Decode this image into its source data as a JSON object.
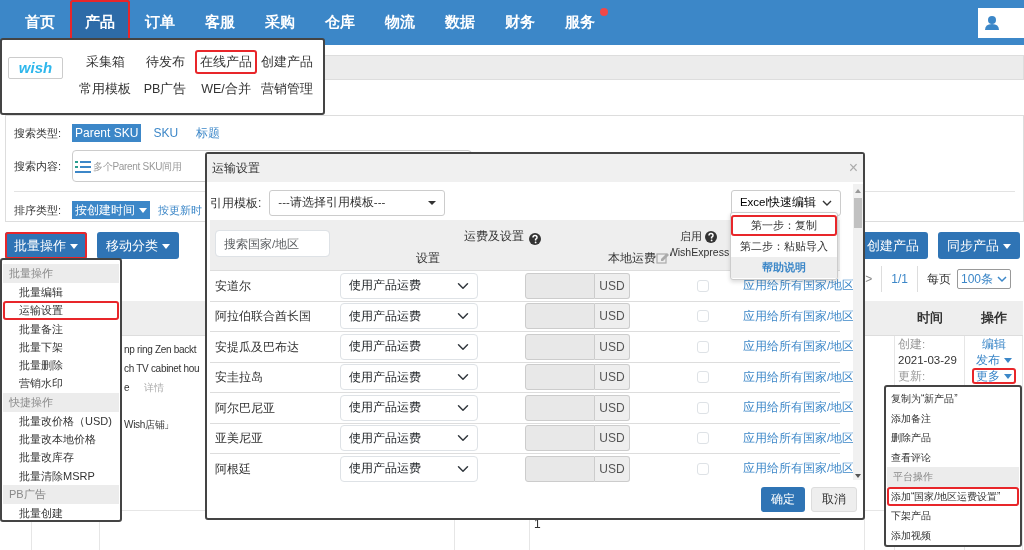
{
  "nav": {
    "items": [
      {
        "label": "首页",
        "selected": false,
        "annotated": false,
        "dot": false
      },
      {
        "label": "产品",
        "selected": true,
        "annotated": true,
        "dot": false
      },
      {
        "label": "订单",
        "selected": false,
        "annotated": false,
        "dot": false
      },
      {
        "label": "客服",
        "selected": false,
        "annotated": false,
        "dot": false
      },
      {
        "label": "采购",
        "selected": false,
        "annotated": false,
        "dot": false
      },
      {
        "label": "仓库",
        "selected": false,
        "annotated": false,
        "dot": false
      },
      {
        "label": "物流",
        "selected": false,
        "annotated": false,
        "dot": false
      },
      {
        "label": "数据",
        "selected": false,
        "annotated": false,
        "dot": false
      },
      {
        "label": "财务",
        "selected": false,
        "annotated": false,
        "dot": false
      },
      {
        "label": "服务",
        "selected": false,
        "annotated": false,
        "dot": true
      }
    ]
  },
  "product_menu": {
    "logo": "wish",
    "items": [
      {
        "label": "采集箱",
        "annotated": false
      },
      {
        "label": "待发布",
        "annotated": false
      },
      {
        "label": "在线产品",
        "annotated": true
      },
      {
        "label": "创建产品",
        "annotated": false
      },
      {
        "label": "常用模板",
        "annotated": false
      },
      {
        "label": "PB广告",
        "annotated": false
      },
      {
        "label": "WE/合并",
        "annotated": false
      },
      {
        "label": "营销管理",
        "annotated": false
      }
    ]
  },
  "search": {
    "type_label": "搜索类型:",
    "types": [
      {
        "label": "Parent SKU",
        "selected": true
      },
      {
        "label": "SKU",
        "selected": false
      },
      {
        "label": "标题",
        "selected": false
      }
    ],
    "content_label": "搜索内容:",
    "placeholder": "多个Parent SKU间用",
    "sort_label": "排序类型:",
    "sorts": [
      {
        "label": "按创建时间",
        "selected": true
      },
      {
        "label": "按更新时",
        "selected": false
      }
    ]
  },
  "toolbar": {
    "left": [
      {
        "label": "批量操作",
        "dropdown": true,
        "annotated": true
      },
      {
        "label": "移动分类",
        "dropdown": true,
        "annotated": false
      }
    ],
    "right": [
      {
        "label": "创建产品",
        "dropdown": false,
        "annotated": false
      },
      {
        "label": "同步产品",
        "dropdown": true,
        "annotated": false
      }
    ]
  },
  "pagination": {
    "next": ">",
    "pages": "1/1",
    "per_page_label": "每页",
    "per_page": "100条"
  },
  "table": {
    "columns": [
      "时间",
      "操作"
    ],
    "product": {
      "title_lines": [
        "np ring Zen backt",
        "ch TV cabinet hou",
        "e"
      ],
      "detail_link": "详情",
      "shop": "Wish店铺」",
      "created_label": "创建:",
      "created": "2021-03-29",
      "updated_label": "更新:",
      "actions": [
        {
          "label": "编辑",
          "dropdown": false,
          "annotated": false
        },
        {
          "label": "发布",
          "dropdown": true,
          "annotated": false
        },
        {
          "label": "更多",
          "dropdown": true,
          "annotated": true
        }
      ]
    },
    "next_row_cell": "1"
  },
  "bulk_menu": {
    "items": [
      {
        "kind": "header",
        "label": "批量操作",
        "annotated": false
      },
      {
        "kind": "item",
        "label": "批量编辑",
        "annotated": false
      },
      {
        "kind": "item",
        "label": "运输设置",
        "annotated": true
      },
      {
        "kind": "item",
        "label": "批量备注",
        "annotated": false
      },
      {
        "kind": "item",
        "label": "批量下架",
        "annotated": false
      },
      {
        "kind": "item",
        "label": "批量删除",
        "annotated": false
      },
      {
        "kind": "item",
        "label": "营销水印",
        "annotated": false
      },
      {
        "kind": "header",
        "label": "快捷操作",
        "annotated": false
      },
      {
        "kind": "item",
        "label": "批量改价格（USD)",
        "annotated": false
      },
      {
        "kind": "item",
        "label": "批量改本地价格",
        "annotated": false
      },
      {
        "kind": "item",
        "label": "批量改库存",
        "annotated": false
      },
      {
        "kind": "item",
        "label": "批量清除MSRP",
        "annotated": false
      },
      {
        "kind": "header",
        "label": "PB广告",
        "annotated": false
      },
      {
        "kind": "item",
        "label": "批量创建",
        "annotated": false
      }
    ]
  },
  "modal": {
    "title": "运输设置",
    "close": "×",
    "template_label": "引用模板:",
    "template_placeholder": "---请选择引用模板---",
    "excel_button": "Excel快速编辑",
    "search_placeholder": "搜索国家/地区",
    "group_header": "运费及设置",
    "col_setting": "设置",
    "col_local_fee": "本地运费",
    "col_enable": "启用",
    "col_enable_sub": "WishExpress",
    "rows": [
      {
        "country": "安道尔",
        "setting": "使用产品运费",
        "currency": "USD",
        "checked": false,
        "apply_link": "应用给所有国家/地区"
      },
      {
        "country": "阿拉伯联合酋长国",
        "setting": "使用产品运费",
        "currency": "USD",
        "checked": false,
        "apply_link": "应用给所有国家/地区"
      },
      {
        "country": "安提瓜及巴布达",
        "setting": "使用产品运费",
        "currency": "USD",
        "checked": false,
        "apply_link": "应用给所有国家/地区"
      },
      {
        "country": "安圭拉岛",
        "setting": "使用产品运费",
        "currency": "USD",
        "checked": false,
        "apply_link": "应用给所有国家/地区"
      },
      {
        "country": "阿尔巴尼亚",
        "setting": "使用产品运费",
        "currency": "USD",
        "checked": false,
        "apply_link": "应用给所有国家/地区"
      },
      {
        "country": "亚美尼亚",
        "setting": "使用产品运费",
        "currency": "USD",
        "checked": false,
        "apply_link": "应用给所有国家/地区"
      },
      {
        "country": "阿根廷",
        "setting": "使用产品运费",
        "currency": "USD",
        "checked": false,
        "apply_link": "应用给所有国家/地区"
      }
    ],
    "ok": "确定",
    "cancel": "取消"
  },
  "excel_menu": {
    "items": [
      {
        "kind": "item",
        "label": "第一步：复制",
        "annotated": true
      },
      {
        "kind": "item",
        "label": "第二步：粘贴导入",
        "annotated": false
      },
      {
        "kind": "help",
        "label": "帮助说明",
        "annotated": false
      }
    ]
  },
  "more_menu": {
    "items": [
      {
        "kind": "item",
        "label": "复制为“新产品”",
        "annotated": false
      },
      {
        "kind": "item",
        "label": "添加备注",
        "annotated": false
      },
      {
        "kind": "item",
        "label": "删除产品",
        "annotated": false
      },
      {
        "kind": "item",
        "label": "查看评论",
        "annotated": false
      },
      {
        "kind": "header",
        "label": "平台操作",
        "annotated": false
      },
      {
        "kind": "item",
        "label": "添加“国家/地区运费设置”",
        "annotated": true
      },
      {
        "kind": "item",
        "label": "下架产品",
        "annotated": false
      },
      {
        "kind": "item",
        "label": "添加视频",
        "annotated": false
      }
    ]
  }
}
